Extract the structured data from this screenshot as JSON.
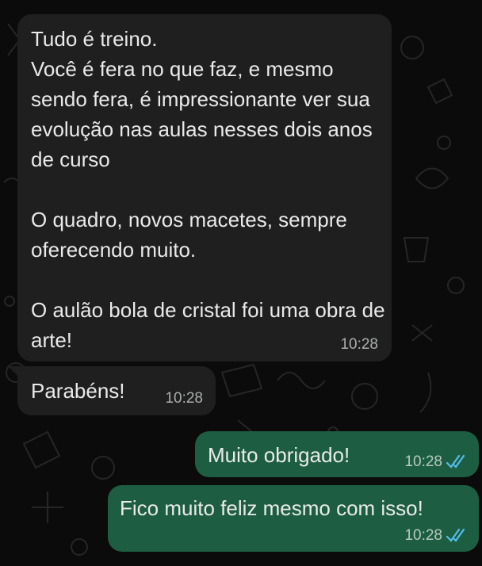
{
  "chat": {
    "messages": [
      {
        "direction": "incoming",
        "text": "Tudo é treino.\nVocê é fera no que faz, e mesmo sendo fera, é impressionante ver sua evolução nas aulas nesses dois anos de curso\n\nO quadro, novos macetes, sempre oferecendo muito.\n\nO aulão bola de cristal foi uma obra de arte!",
        "time": "10:28"
      },
      {
        "direction": "incoming",
        "text": "Parabéns!",
        "time": "10:28"
      },
      {
        "direction": "outgoing",
        "text": "Muito obrigado!",
        "time": "10:28",
        "status_icon": "double-check-read-icon"
      },
      {
        "direction": "outgoing",
        "text": "Fico muito feliz mesmo com isso!",
        "time": "10:28",
        "status_icon": "double-check-read-icon"
      }
    ]
  },
  "colors": {
    "background": "#0b0b0b",
    "incoming_bubble": "#1f1f1f",
    "outgoing_bubble": "#1d5e42",
    "read_ticks": "#53bdeb"
  }
}
